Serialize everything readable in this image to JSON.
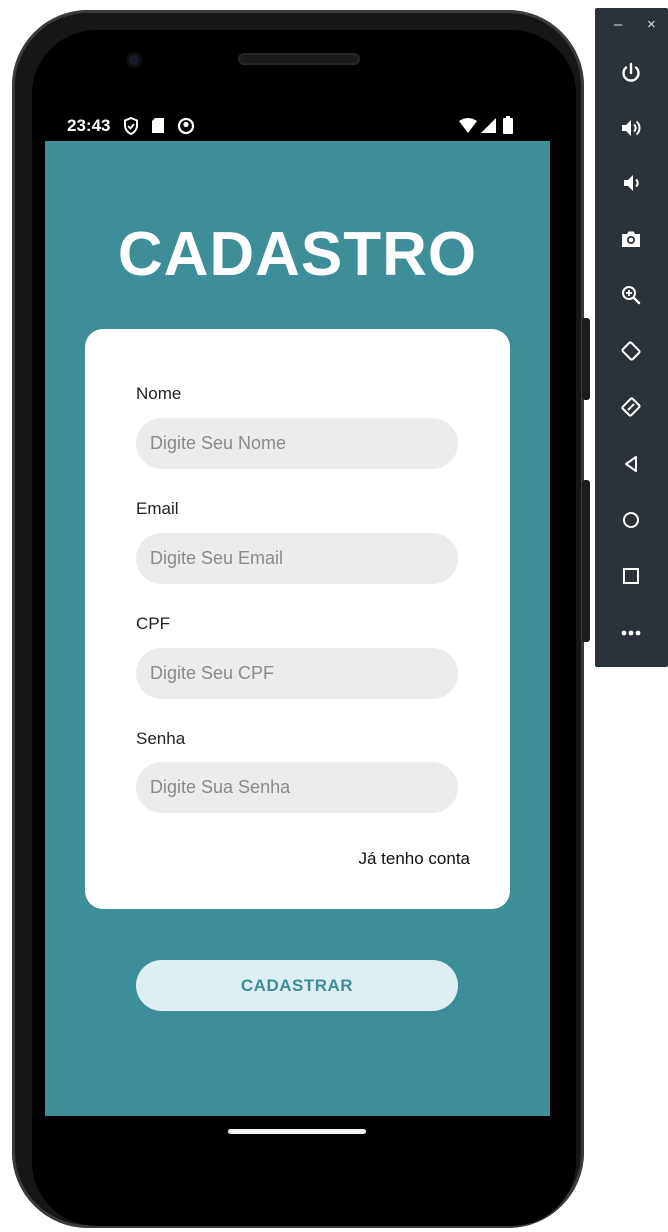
{
  "status_bar": {
    "time": "23:43",
    "icons_left": [
      "shield-icon",
      "sd-card-icon",
      "sync-icon"
    ],
    "icons_right": [
      "wifi-icon",
      "signal-icon",
      "battery-icon"
    ]
  },
  "app": {
    "title": "CADASTRO",
    "background_color": "#3d8e99",
    "fields": [
      {
        "label": "Nome",
        "placeholder": "Digite Seu Nome",
        "value": ""
      },
      {
        "label": "Email",
        "placeholder": "Digite Seu Email",
        "value": ""
      },
      {
        "label": "CPF",
        "placeholder": "Digite Seu CPF",
        "value": ""
      },
      {
        "label": "Senha",
        "placeholder": "Digite Sua Senha",
        "value": ""
      }
    ],
    "login_link": "Já tenho conta",
    "submit_label": "CADASTRAR"
  },
  "emulator_panel": {
    "window_controls": {
      "minimize": "–",
      "close": "×"
    },
    "buttons": [
      "power-icon",
      "volume-up-icon",
      "volume-down-icon",
      "camera-icon",
      "zoom-icon",
      "rotate-left-icon",
      "rotate-right-icon",
      "back-icon",
      "home-icon",
      "overview-icon",
      "more-icon"
    ]
  }
}
